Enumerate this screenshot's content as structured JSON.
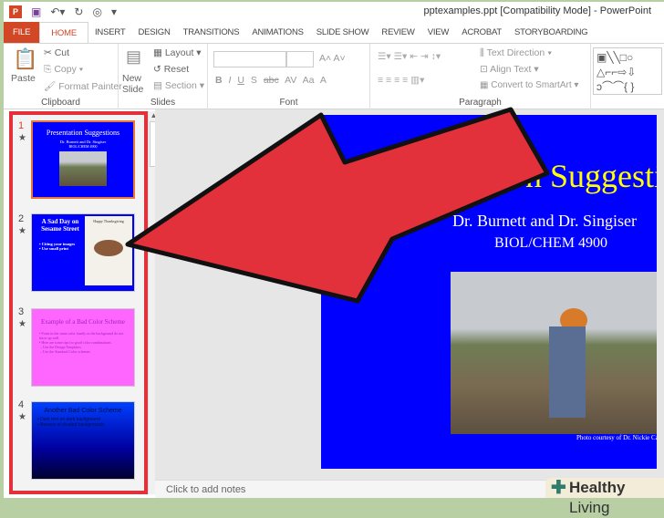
{
  "window": {
    "title": "pptexamples.ppt [Compatibility Mode] - PowerPoint"
  },
  "quick_access": [
    "save-icon",
    "undo-icon",
    "redo-icon",
    "present-icon",
    "customize-icon"
  ],
  "tabs": [
    "FILE",
    "HOME",
    "INSERT",
    "DESIGN",
    "TRANSITIONS",
    "ANIMATIONS",
    "SLIDE SHOW",
    "REVIEW",
    "VIEW",
    "ACROBAT",
    "STORYBOARDING"
  ],
  "active_tab": "HOME",
  "ribbon": {
    "clipboard": {
      "label": "Clipboard",
      "paste": "Paste",
      "cut": "Cut",
      "copy": "Copy",
      "format_painter": "Format Painter"
    },
    "slides": {
      "label": "Slides",
      "new_slide": "New Slide",
      "layout": "Layout",
      "reset": "Reset",
      "section": "Section"
    },
    "font": {
      "label": "Font",
      "bold": "B",
      "italic": "I",
      "underline": "U",
      "shadow": "S",
      "strike": "abc",
      "spacing": "AV",
      "case": "Aa",
      "color": "A"
    },
    "paragraph": {
      "label": "Paragraph",
      "text_direction": "Text Direction",
      "align_text": "Align Text",
      "smartart": "Convert to SmartArt"
    }
  },
  "thumbnails": [
    {
      "num": "1",
      "title": "Presentation Suggestions",
      "sub": "Dr. Burnett and Dr. Singiser",
      "sub2": "BIOL/CHEM 4900"
    },
    {
      "num": "2",
      "title": "A Sad Day on Sesame Street",
      "bullets": [
        "Citing your images",
        "Use small print"
      ],
      "banner": "Happy Thanksgiving"
    },
    {
      "num": "3",
      "title": "Example of a Bad Color Scheme",
      "bullets": [
        "Fonts in the same color family as the background do not show up well.",
        "Here are some tips for good color combinations",
        "Use the Design Templates",
        "Use the Standard Color schemes"
      ]
    },
    {
      "num": "4",
      "title": "Another Bad Color Scheme",
      "bullets": [
        "Dark text on dark background",
        "Beware of shaded backgrounds"
      ]
    }
  ],
  "slide": {
    "title": "Presentation Suggestions",
    "subtitle": "Dr. Burnett and Dr. Singiser",
    "course": "BIOL/CHEM 4900",
    "credit": "Photo courtesy of Dr. Nickie Cauthen"
  },
  "notes_placeholder": "Click to add notes",
  "watermark": {
    "bold": "Healthy",
    "rest": " Living"
  },
  "colors": {
    "accent": "#d24726",
    "highlight": "#e2313b",
    "slide_bg": "#0000ff",
    "title": "#ffff00"
  }
}
